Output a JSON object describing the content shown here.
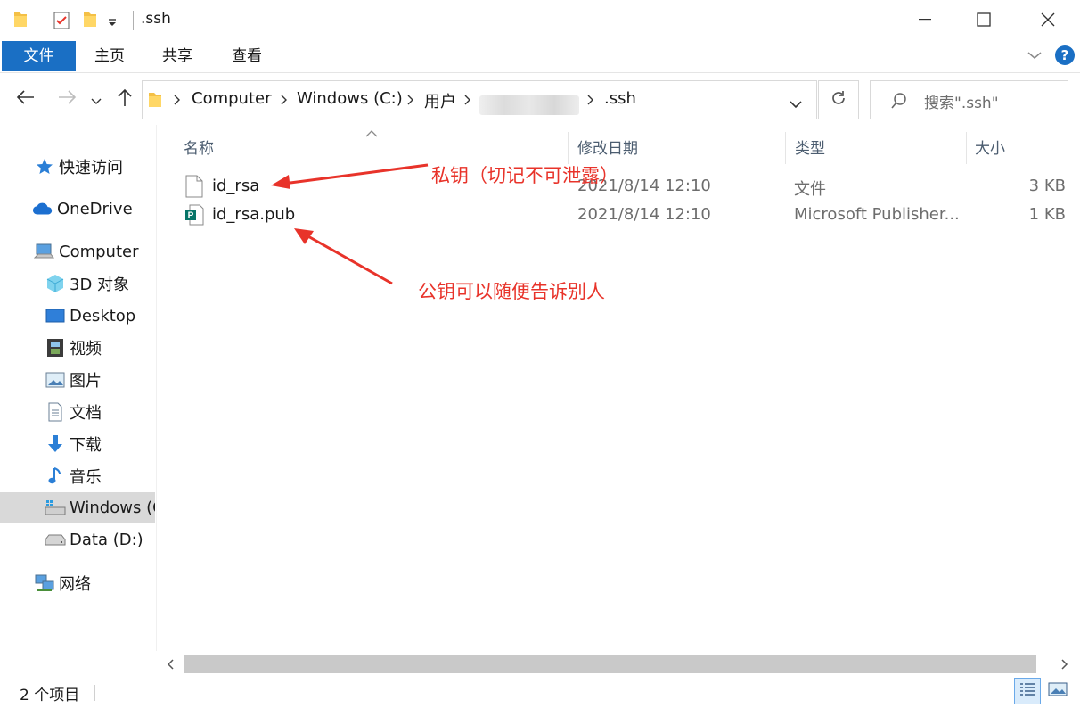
{
  "window": {
    "title": ".ssh",
    "minimize_symbol": "—",
    "maximize_symbol": "☐",
    "close_symbol": "✕"
  },
  "ribbon": {
    "tabs": [
      {
        "label": "文件"
      },
      {
        "label": "主页"
      },
      {
        "label": "共享"
      },
      {
        "label": "查看"
      }
    ],
    "help": "?"
  },
  "address": {
    "crumbs": [
      "Computer",
      "Windows (C:)",
      "用户",
      ".ssh"
    ],
    "search_placeholder": "搜索\".ssh\""
  },
  "sidebar": {
    "items": [
      {
        "label": "快速访问",
        "icon": "star-icon"
      },
      {
        "label": "OneDrive",
        "icon": "cloud-icon"
      },
      {
        "label": "Computer",
        "icon": "computer-icon"
      },
      {
        "label": "3D 对象",
        "icon": "cube-icon"
      },
      {
        "label": "Desktop",
        "icon": "desktop-icon"
      },
      {
        "label": "视频",
        "icon": "film-icon"
      },
      {
        "label": "图片",
        "icon": "picture-icon"
      },
      {
        "label": "文档",
        "icon": "document-icon"
      },
      {
        "label": "下载",
        "icon": "download-icon"
      },
      {
        "label": "音乐",
        "icon": "music-icon"
      },
      {
        "label": "Windows (C:)",
        "icon": "drive-icon",
        "selected": true
      },
      {
        "label": "Data (D:)",
        "icon": "drive-icon"
      },
      {
        "label": "网络",
        "icon": "network-icon"
      }
    ]
  },
  "columns": {
    "name": "名称",
    "date": "修改日期",
    "type": "类型",
    "size": "大小"
  },
  "files": [
    {
      "name": "id_rsa",
      "date": "2021/8/14 12:10",
      "type": "文件",
      "size": "3 KB",
      "icon": "blank-file-icon"
    },
    {
      "name": "id_rsa.pub",
      "date": "2021/8/14 12:10",
      "type": "Microsoft Publisher...",
      "size": "1 KB",
      "icon": "publisher-file-icon"
    }
  ],
  "annotations": {
    "private_key": "私钥（切记不可泄露）",
    "public_key": "公钥可以随便告诉别人",
    "color": "#e8332a"
  },
  "status": {
    "item_count": "2 个项目"
  },
  "colors": {
    "accent": "#1a6fc4",
    "selected_bg": "#d9d9d9"
  }
}
